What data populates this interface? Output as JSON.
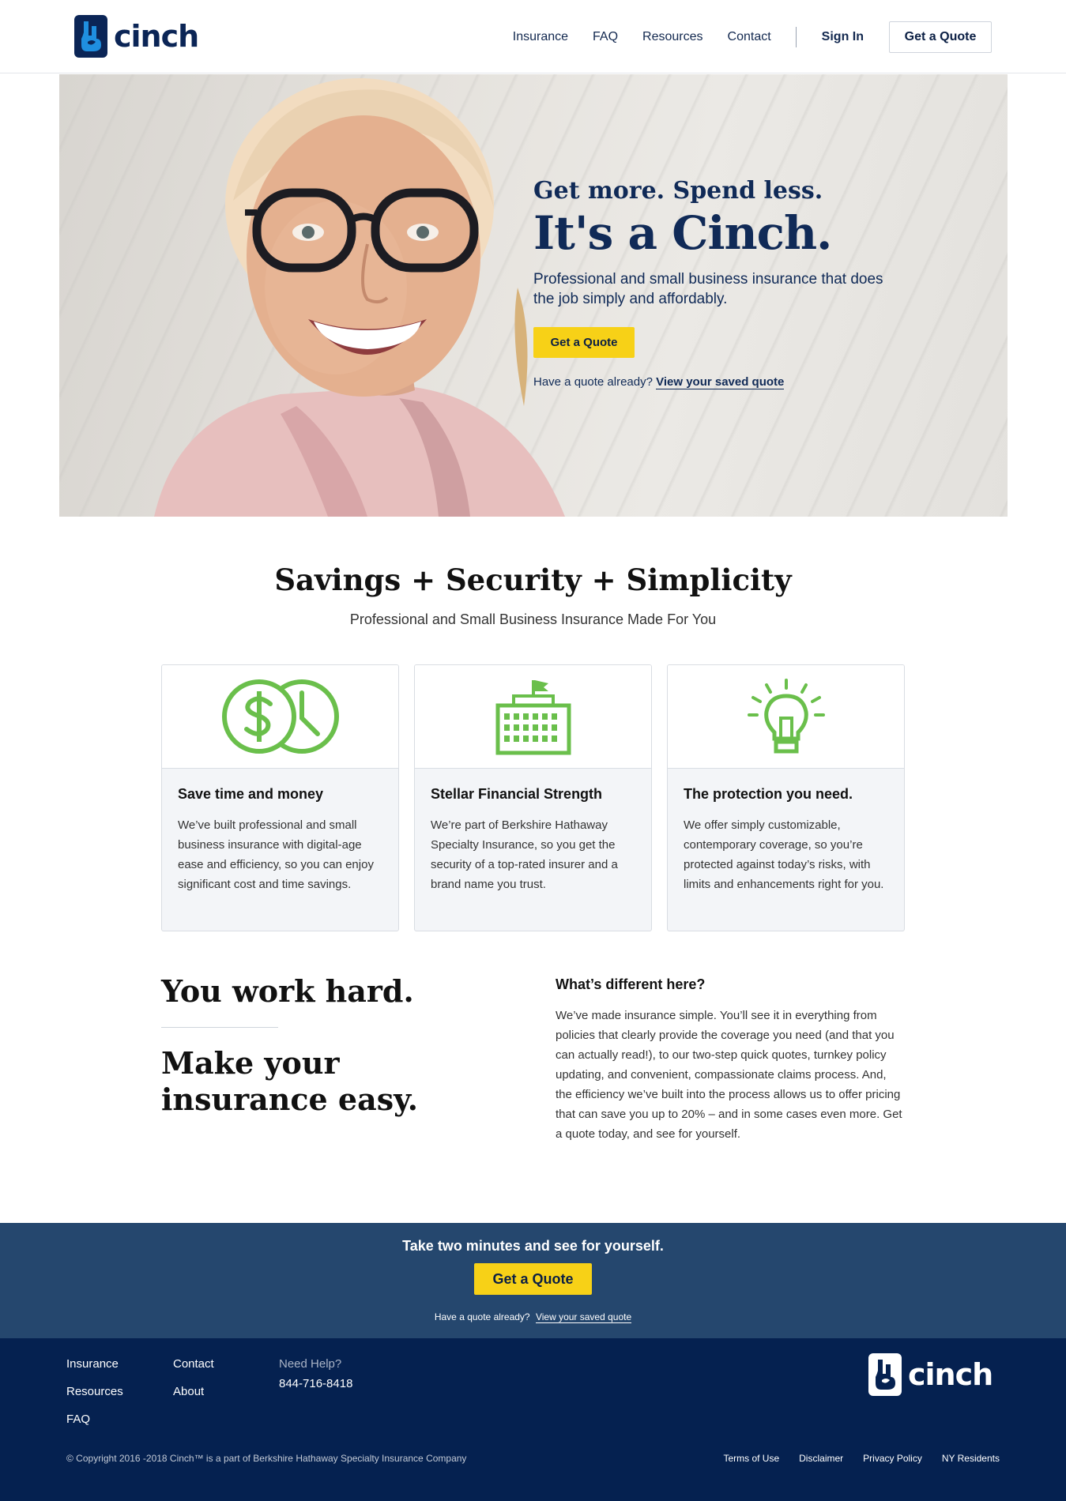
{
  "brand": {
    "name": "cinch",
    "tm": "™"
  },
  "nav": {
    "links": [
      "Insurance",
      "FAQ",
      "Resources",
      "Contact"
    ],
    "sign_in": "Sign In",
    "get_quote": "Get a Quote"
  },
  "hero": {
    "kicker": "Get more. Spend less.",
    "title": "It's a Cinch.",
    "subtitle": "Professional and small business insurance that does the job simply and affordably.",
    "cta": "Get a Quote",
    "have_quote": "Have a quote already?",
    "saved_quote_link": "View your saved quote"
  },
  "values": {
    "title": "Savings + Security + Simplicity",
    "subtitle": "Professional and Small Business Insurance Made For You",
    "cards": [
      {
        "icon": "dollar-clock-icon",
        "title": "Save time and money",
        "text": "We’ve built professional and small business insurance with digital-age ease and efficiency, so you can enjoy significant cost and time savings."
      },
      {
        "icon": "building-icon",
        "title": "Stellar Financial Strength",
        "text": "We’re part of Berkshire Hathaway Specialty Insurance, so you get the security of a top-rated insurer and a brand name you trust."
      },
      {
        "icon": "lightbulb-icon",
        "title": "The protection you need.",
        "text": "We offer simply customizable, contemporary coverage, so you’re protected against today’s risks, with limits and enhancements right for you."
      }
    ],
    "icon_color": "#6abf4b"
  },
  "different": {
    "heading1": "You work hard.",
    "heading2": "Make your insurance easy.",
    "question": "What’s different here?",
    "body": "We’ve made insurance simple. You’ll see it in everything from policies that clearly provide the coverage you need (and that you can actually read!), to our two-step quick quotes, turnkey policy updating, and convenient, compassionate claims process. And, the efficiency we’ve built into the process allows us to offer pricing that can save you up to 20% – and in some cases even more. Get a quote today, and see for yourself."
  },
  "cta_band": {
    "title": "Take two minutes and see for yourself.",
    "button": "Get a Quote",
    "have_quote": "Have a quote already?",
    "saved_quote_link": "View your saved quote"
  },
  "footer": {
    "col1": [
      "Insurance",
      "Resources",
      "FAQ"
    ],
    "col2": [
      "Contact",
      "About"
    ],
    "help_label": "Need Help?",
    "phone": "844-716-8418",
    "copyright": "© Copyright 2016 -2018 Cinch™ is a part of Berkshire Hathaway Specialty Insurance Company",
    "legal_links": [
      "Terms of Use",
      "Disclaimer",
      "Privacy Policy",
      "NY Residents"
    ]
  },
  "colors": {
    "navy": "#0b2556",
    "accent_yellow": "#f7d117",
    "cta_band": "#25476e",
    "footer": "#052150"
  }
}
